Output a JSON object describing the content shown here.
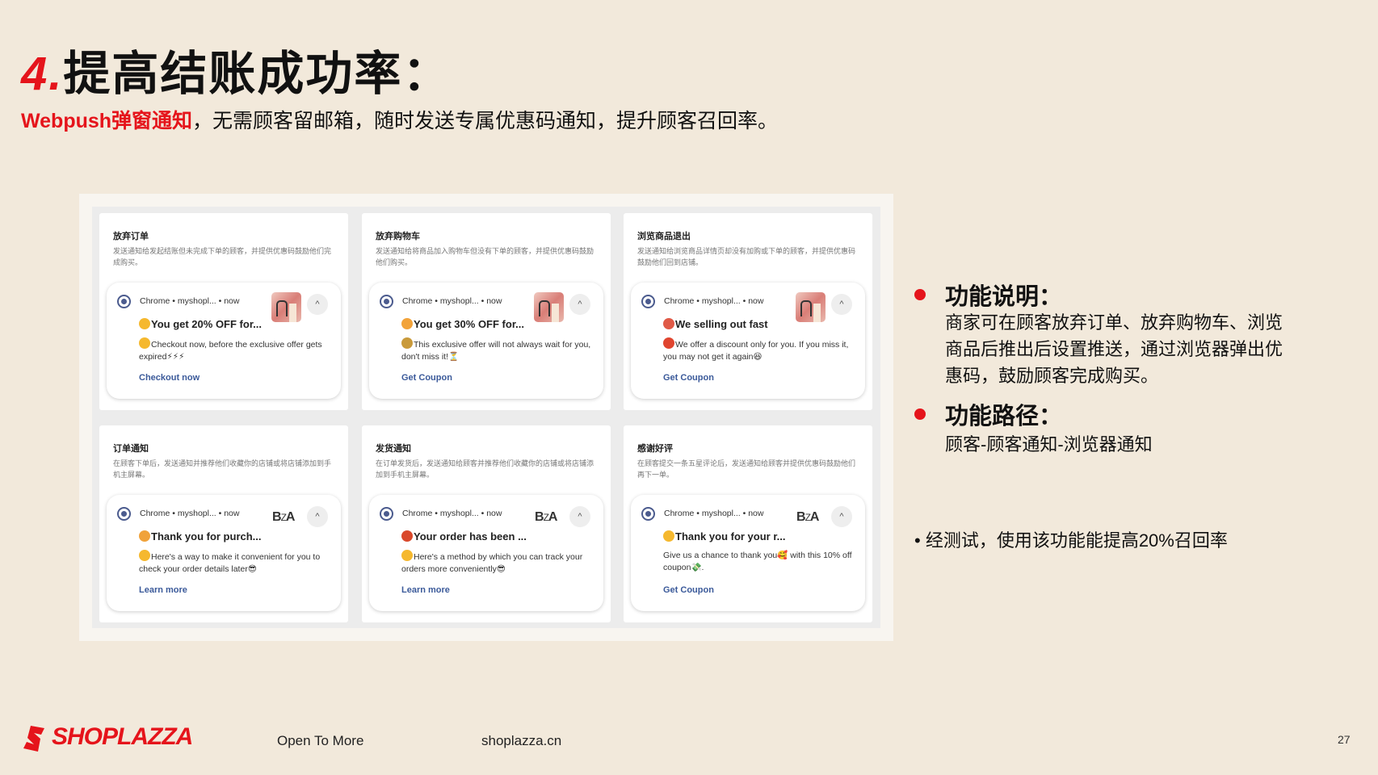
{
  "header": {
    "title_num": "4.",
    "title_text": "提高结账成功率：",
    "subtitle_highlight": "Webpush弹窗通知",
    "subtitle_rest": "，无需顾客留邮箱，随时发送专属优惠码通知，提升顾客召回率。"
  },
  "cards": [
    {
      "title": "放弃订单",
      "desc": "发送通知给发起结账但未完成下单的顾客，并提供优惠码鼓励他们完成购买。",
      "source": "Chrome • myshopl... • now",
      "heading": "You get 20% OFF for...",
      "heading_emoji_color": "#f5b82e",
      "body": "Checkout now, before the exclusive offer gets expired⚡⚡⚡",
      "body_emoji_color": "#f5b82e",
      "link": "Checkout now",
      "image": "product-thumbnail"
    },
    {
      "title": "放弃购物车",
      "desc": "发送通知给将商品加入购物车但没有下单的顾客，并提供优惠码鼓励他们购买。",
      "source": "Chrome • myshopl... • now",
      "heading": "You get 30% OFF for...",
      "heading_emoji_color": "#f2a33a",
      "body": "This exclusive offer will not always wait for you, don't miss it!⏳",
      "body_emoji_color": "#c99a3b",
      "link": "Get Coupon",
      "image": "product-thumbnail"
    },
    {
      "title": "浏览商品退出",
      "desc": "发送通知给浏览商品详情页却没有加购或下单的顾客，并提供优惠码鼓励他们回到店铺。",
      "source": "Chrome • myshopl... • now",
      "heading": "We selling out fast",
      "heading_emoji_color": "#e05a47",
      "body": "We offer a discount only for you. If you miss it, you may not get it again😆",
      "body_emoji_color": "#e0452f",
      "link": "Get Coupon",
      "image": "product-thumbnail"
    },
    {
      "title": "订单通知",
      "desc": "在顾客下单后，发送通知并推荐他们收藏你的店铺或将店铺添加到手机主屏幕。",
      "source": "Chrome • myshopl... • now",
      "heading": "Thank you for purch...",
      "heading_emoji_color": "#f0a23a",
      "body": "Here's a way to make it convenient for you to check your order details later😎",
      "body_emoji_color": "#f5b82e",
      "link": "Learn more",
      "image": "brand-logo"
    },
    {
      "title": "发货通知",
      "desc": "在订单发货后，发送通知给顾客并推荐他们收藏你的店铺或将店铺添加到手机主屏幕。",
      "source": "Chrome • myshopl... • now",
      "heading": "Your order has been ...",
      "heading_emoji_color": "#d9482b",
      "body": "Here's a method by which you can track your orders more conveniently😎",
      "body_emoji_color": "#f5b82e",
      "link": "Learn more",
      "image": "brand-logo"
    },
    {
      "title": "感谢好评",
      "desc": "在顾客提交一条五星评论后，发送通知给顾客并提供优惠码鼓励他们再下一单。",
      "source": "Chrome • myshopl... • now",
      "heading": "Thank you for your r...",
      "heading_emoji_color": "#f5b82e",
      "body": "Give us a chance to thank you🥰 with this 10% off coupon💸.",
      "body_emoji_color": "",
      "link": "Get Coupon",
      "image": "brand-logo"
    }
  ],
  "brand_logo_text": {
    "left": "B",
    "mid": "Z",
    "right": "A"
  },
  "collapse_icon": "^",
  "bullets": [
    {
      "title": "功能说明：",
      "body": "商家可在顾客放弃订单、放弃购物车、浏览商品后推出后设置推送，通过浏览器弹出优惠码，鼓励顾客完成购买。"
    },
    {
      "title": "功能路径：",
      "body": "顾客-顾客通知-浏览器通知"
    }
  ],
  "note": "• 经测试，使用该功能能提高20%召回率",
  "footer": {
    "logo_text": "SHOPLAZZA",
    "tagline": "Open To More",
    "website": "shoplazza.cn",
    "page_number": "27"
  },
  "colors": {
    "accent": "#e5141b",
    "background": "#f2e9db",
    "link": "#3b5a9a"
  }
}
